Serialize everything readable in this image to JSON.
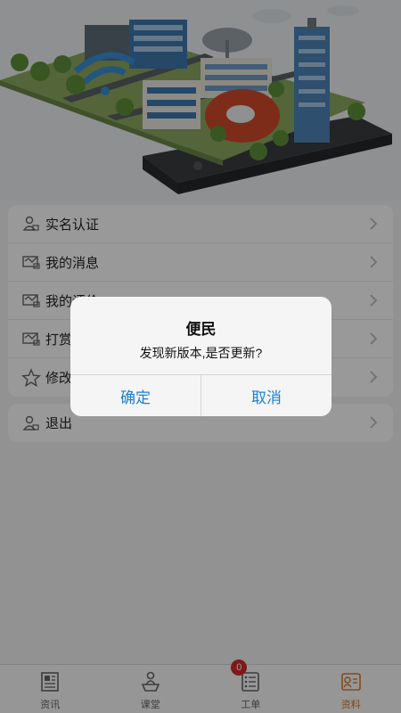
{
  "menu": {
    "group1": [
      {
        "label": "实名认证",
        "icon": "id-card-icon"
      },
      {
        "label": "我的消息",
        "icon": "message-icon"
      },
      {
        "label": "我的评价",
        "icon": "review-icon"
      },
      {
        "label": "打赏记录",
        "icon": "reward-icon"
      },
      {
        "label": "修改密码",
        "icon": "star-icon"
      }
    ],
    "group2": [
      {
        "label": "退出",
        "icon": "logout-icon"
      }
    ]
  },
  "dialog": {
    "title": "便民",
    "message": "发现新版本,是否更新?",
    "confirm": "确定",
    "cancel": "取消"
  },
  "tabs": [
    {
      "label": "资讯",
      "icon": "news-icon",
      "active": false
    },
    {
      "label": "课堂",
      "icon": "classroom-icon",
      "active": false
    },
    {
      "label": "工单",
      "icon": "workorder-icon",
      "active": false,
      "badge": "0"
    },
    {
      "label": "资料",
      "icon": "profile-icon",
      "active": true
    }
  ],
  "colors": {
    "accent": "#1a7fdc",
    "active_tab": "#e07b2a",
    "badge": "#d42a2a",
    "overlay": "rgba(0,0,0,0.40)"
  }
}
